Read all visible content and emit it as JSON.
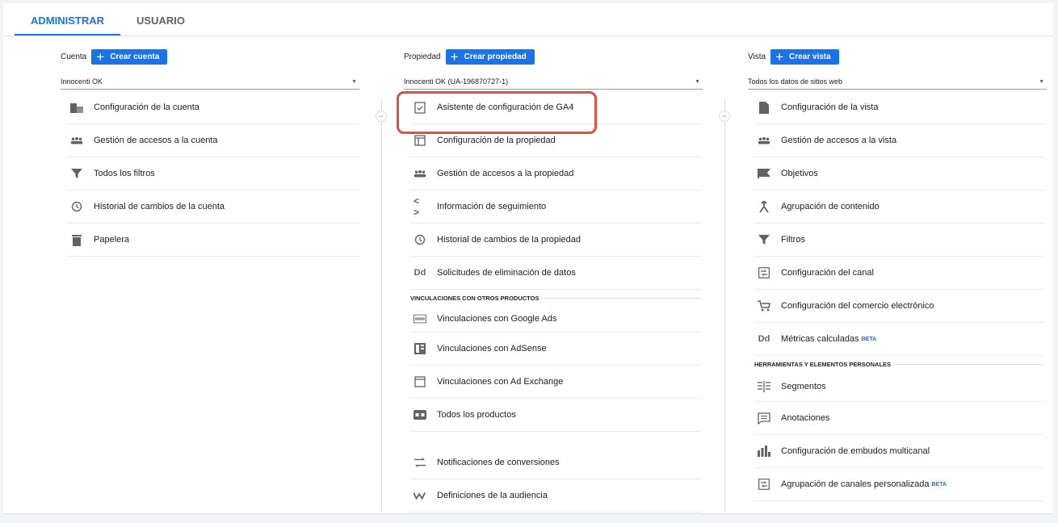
{
  "tabs": [
    "ADMINISTRAR",
    "USUARIO"
  ],
  "cuenta": {
    "label": "Cuenta",
    "create_label": "Crear cuenta",
    "selected": "Innocenti OK",
    "items": [
      {
        "label": "Configuración de la cuenta",
        "icon": "building-icon"
      },
      {
        "label": "Gestión de accesos a la cuenta",
        "icon": "people-icon"
      },
      {
        "label": "Todos los filtros",
        "icon": "filter-icon"
      },
      {
        "label": "Historial de cambios de la cuenta",
        "icon": "history-icon"
      },
      {
        "label": "Papelera",
        "icon": "trash-icon"
      }
    ]
  },
  "propiedad": {
    "label": "Propiedad",
    "create_label": "Crear propiedad",
    "selected": "Innocenti OK (UA-196870727-1)",
    "items": [
      {
        "label": "Asistente de configuración de GA4",
        "icon": "checkbox-icon"
      },
      {
        "label": "Configuración de la propiedad",
        "icon": "layout-icon"
      },
      {
        "label": "Gestión de accesos a la propiedad",
        "icon": "people-icon"
      },
      {
        "label": "Información de seguimiento",
        "icon": "code-icon"
      },
      {
        "label": "Historial de cambios de la propiedad",
        "icon": "history-icon"
      },
      {
        "label": "Solicitudes de eliminación de datos",
        "icon": "dd-icon"
      }
    ],
    "section_title": "VINCULACIONES CON OTROS PRODUCTOS",
    "links": [
      {
        "label": "Vinculaciones con Google Ads",
        "icon": "ads-icon"
      },
      {
        "label": "Vinculaciones con AdSense",
        "icon": "adsense-icon"
      },
      {
        "label": "Vinculaciones con Ad Exchange",
        "icon": "adexchange-icon"
      },
      {
        "label": "Todos los productos",
        "icon": "products-icon"
      }
    ],
    "extra": [
      {
        "label": "Notificaciones de conversiones",
        "icon": "swap-icon"
      },
      {
        "label": "Definiciones de la audiencia",
        "icon": "audience-icon"
      }
    ]
  },
  "vista": {
    "label": "Vista",
    "create_label": "Crear vista",
    "selected": "Todos los datos de sitios web",
    "items": [
      {
        "label": "Configuración de la vista",
        "icon": "file-icon",
        "beta": ""
      },
      {
        "label": "Gestión de accesos a la vista",
        "icon": "people-icon",
        "beta": ""
      },
      {
        "label": "Objetivos",
        "icon": "flag-icon",
        "beta": ""
      },
      {
        "label": "Agrupación de contenido",
        "icon": "merge-icon",
        "beta": ""
      },
      {
        "label": "Filtros",
        "icon": "filter-icon",
        "beta": ""
      },
      {
        "label": "Configuración del canal",
        "icon": "channel-icon",
        "beta": ""
      },
      {
        "label": "Configuración del comercio electrónico",
        "icon": "cart-icon",
        "beta": ""
      },
      {
        "label": "Métricas calculadas",
        "icon": "dd-icon",
        "beta": "BETA"
      }
    ],
    "section_title": "HERRAMIENTAS Y ELEMENTOS PERSONALES",
    "tools": [
      {
        "label": "Segmentos",
        "icon": "segments-icon",
        "beta": ""
      },
      {
        "label": "Anotaciones",
        "icon": "comment-icon",
        "beta": ""
      },
      {
        "label": "Configuración de embudos multicanal",
        "icon": "bars-icon",
        "beta": ""
      },
      {
        "label": "Agrupación de canales personalizada",
        "icon": "channel-icon",
        "beta": "BETA"
      }
    ]
  },
  "colors": {
    "accent": "#1a73e8",
    "highlight": "#d9553f",
    "icon": "#5f6368"
  }
}
